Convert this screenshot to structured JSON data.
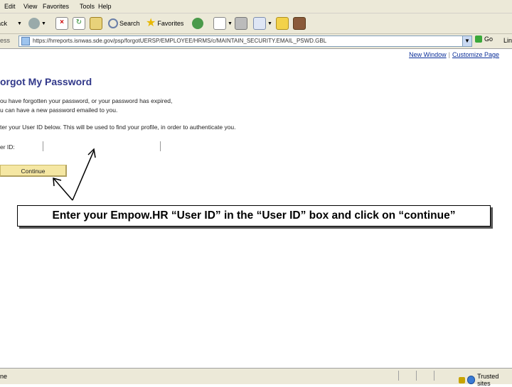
{
  "menu": [
    "Edit",
    "View",
    "Favorites",
    "Tools",
    "Help"
  ],
  "toolbar": {
    "back_label": "Back",
    "search_label": "Search",
    "favorites_label": "Favorites"
  },
  "address": {
    "label": "ess",
    "url": "https://hrreports.isnwas.sde.gov/psp/forgotUERSP/EMPLOYEE/HRMS/c/MAINTAIN_SECURITY.EMAIL_PSWD.GBL",
    "go_label": "Go",
    "links_label": "Lin"
  },
  "page": {
    "top_links": [
      "New Window",
      "Customize Page"
    ],
    "title": "orgot My Password",
    "line1": "ou have forgotten your password, or your password has expired,",
    "line2": "u can have a new password emailed to you.",
    "line3": "ter your User ID below. This will be used to find your profile, in order to authenticate you.",
    "userid_label": "er ID:",
    "userid_value": "",
    "continue_label": "Continue"
  },
  "callout": {
    "text": "Enter your Empow.HR “User ID” in the “User ID” box and click on “continue”"
  },
  "status": {
    "left": "ne",
    "zone": "Trusted sites"
  }
}
